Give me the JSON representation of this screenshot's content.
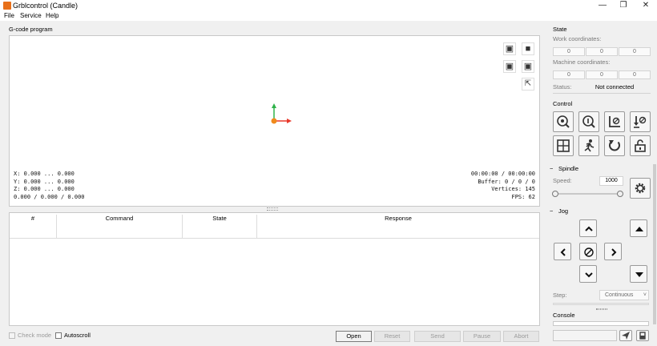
{
  "window": {
    "title": "Grblcontrol (Candle)",
    "controls": {
      "minimize": "—",
      "maximize": "❐",
      "close": "✕"
    }
  },
  "menu": [
    "File",
    "Service",
    "Help"
  ],
  "gcode_program": {
    "title": "G-code program",
    "info_left": [
      "X: 0.000 ... 0.000",
      "Y: 0.000 ... 0.000",
      "Z: 0.000 ... 0.000",
      "0.000 / 0.000 / 0.000"
    ],
    "info_right": [
      "00:00:00 / 00:00:00",
      "Buffer: 0 / 0 / 0",
      "Vertices: 145",
      "FPS: 62"
    ]
  },
  "table": {
    "columns": [
      "#",
      "Command",
      "State",
      "Response"
    ]
  },
  "bottom": {
    "check_mode": "Check mode",
    "autoscroll": "Autoscroll",
    "buttons": {
      "open": "Open",
      "reset": "Reset",
      "send": "Send",
      "pause": "Pause",
      "abort": "Abort"
    }
  },
  "state": {
    "title": "State",
    "work_label": "Work coordinates:",
    "work": [
      "0",
      "0",
      "0"
    ],
    "machine_label": "Machine coordinates:",
    "machine": [
      "0",
      "0",
      "0"
    ],
    "status_label": "Status:",
    "status_value": "Not connected"
  },
  "control": {
    "title": "Control"
  },
  "spindle": {
    "title": "Spindle",
    "speed_label": "Speed:",
    "speed_value": "1000",
    "collapse": "−"
  },
  "jog": {
    "title": "Jog",
    "collapse": "−",
    "step_label": "Step:",
    "step_value": "Continuous"
  },
  "console": {
    "title": "Console"
  },
  "colors": {
    "x_axis": "#e8382a",
    "y_axis": "#2fb24a",
    "origin": "#f08a1c"
  }
}
